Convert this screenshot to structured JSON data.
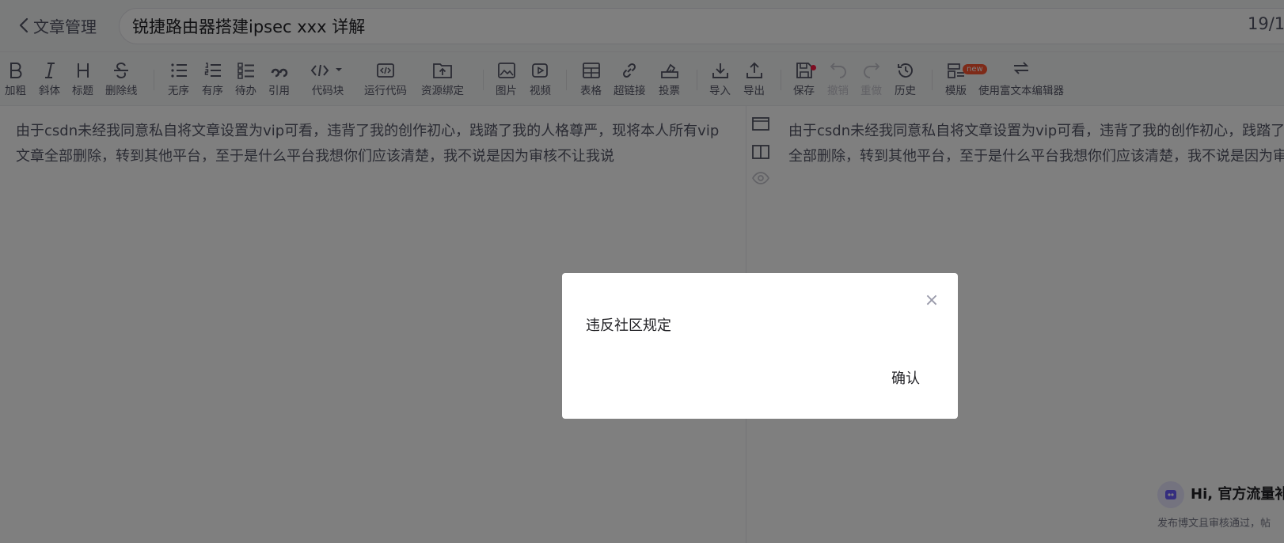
{
  "header": {
    "back_label": "文章管理",
    "title_value": "锐捷路由器搭建ipsec xxx 详解",
    "title_counter": "19/1"
  },
  "toolbar": {
    "bold": "加粗",
    "italic": "斜体",
    "heading": "标题",
    "strikethrough": "删除线",
    "unordered_list": "无序",
    "ordered_list": "有序",
    "todo": "待办",
    "quote": "引用",
    "code_block": "代码块",
    "run_code": "运行代码",
    "resource_bind": "资源绑定",
    "image": "图片",
    "video": "视频",
    "table": "表格",
    "link": "超链接",
    "vote": "投票",
    "import": "导入",
    "export": "导出",
    "save": "保存",
    "undo": "撤销",
    "redo": "重做",
    "history": "历史",
    "template": "模版",
    "template_badge": "new",
    "rich_text": "使用富文本编辑器"
  },
  "editor": {
    "content": "由于csdn未经我同意私自将文章设置为vip可看，违背了我的创作初心，践踏了我的人格尊严，现将本人所有vip文章全部删除，转到其他平台，至于是什么平台我想你们应该清楚，我不说是因为审核不让我说"
  },
  "preview": {
    "content": "由于csdn未经我同意私自将文章设置为vip可看，违背了我的创作初心，践踏了我的人格尊严，现将本人所有vip文章全部删除，转到其他平台，至于是什么平台我想你们应该清楚，我不说是因为审核不让我说"
  },
  "promo": {
    "title": "Hi, 官方流量补",
    "subtitle": "发布博文且审核通过，帖"
  },
  "modal": {
    "message": "违反社区规定",
    "close_symbol": "×",
    "confirm_label": "确认"
  },
  "colors": {
    "accent": "#fc5531",
    "overlay": "rgba(0,0,0,0.5)",
    "text_primary": "#222226",
    "text_secondary": "#555666"
  }
}
